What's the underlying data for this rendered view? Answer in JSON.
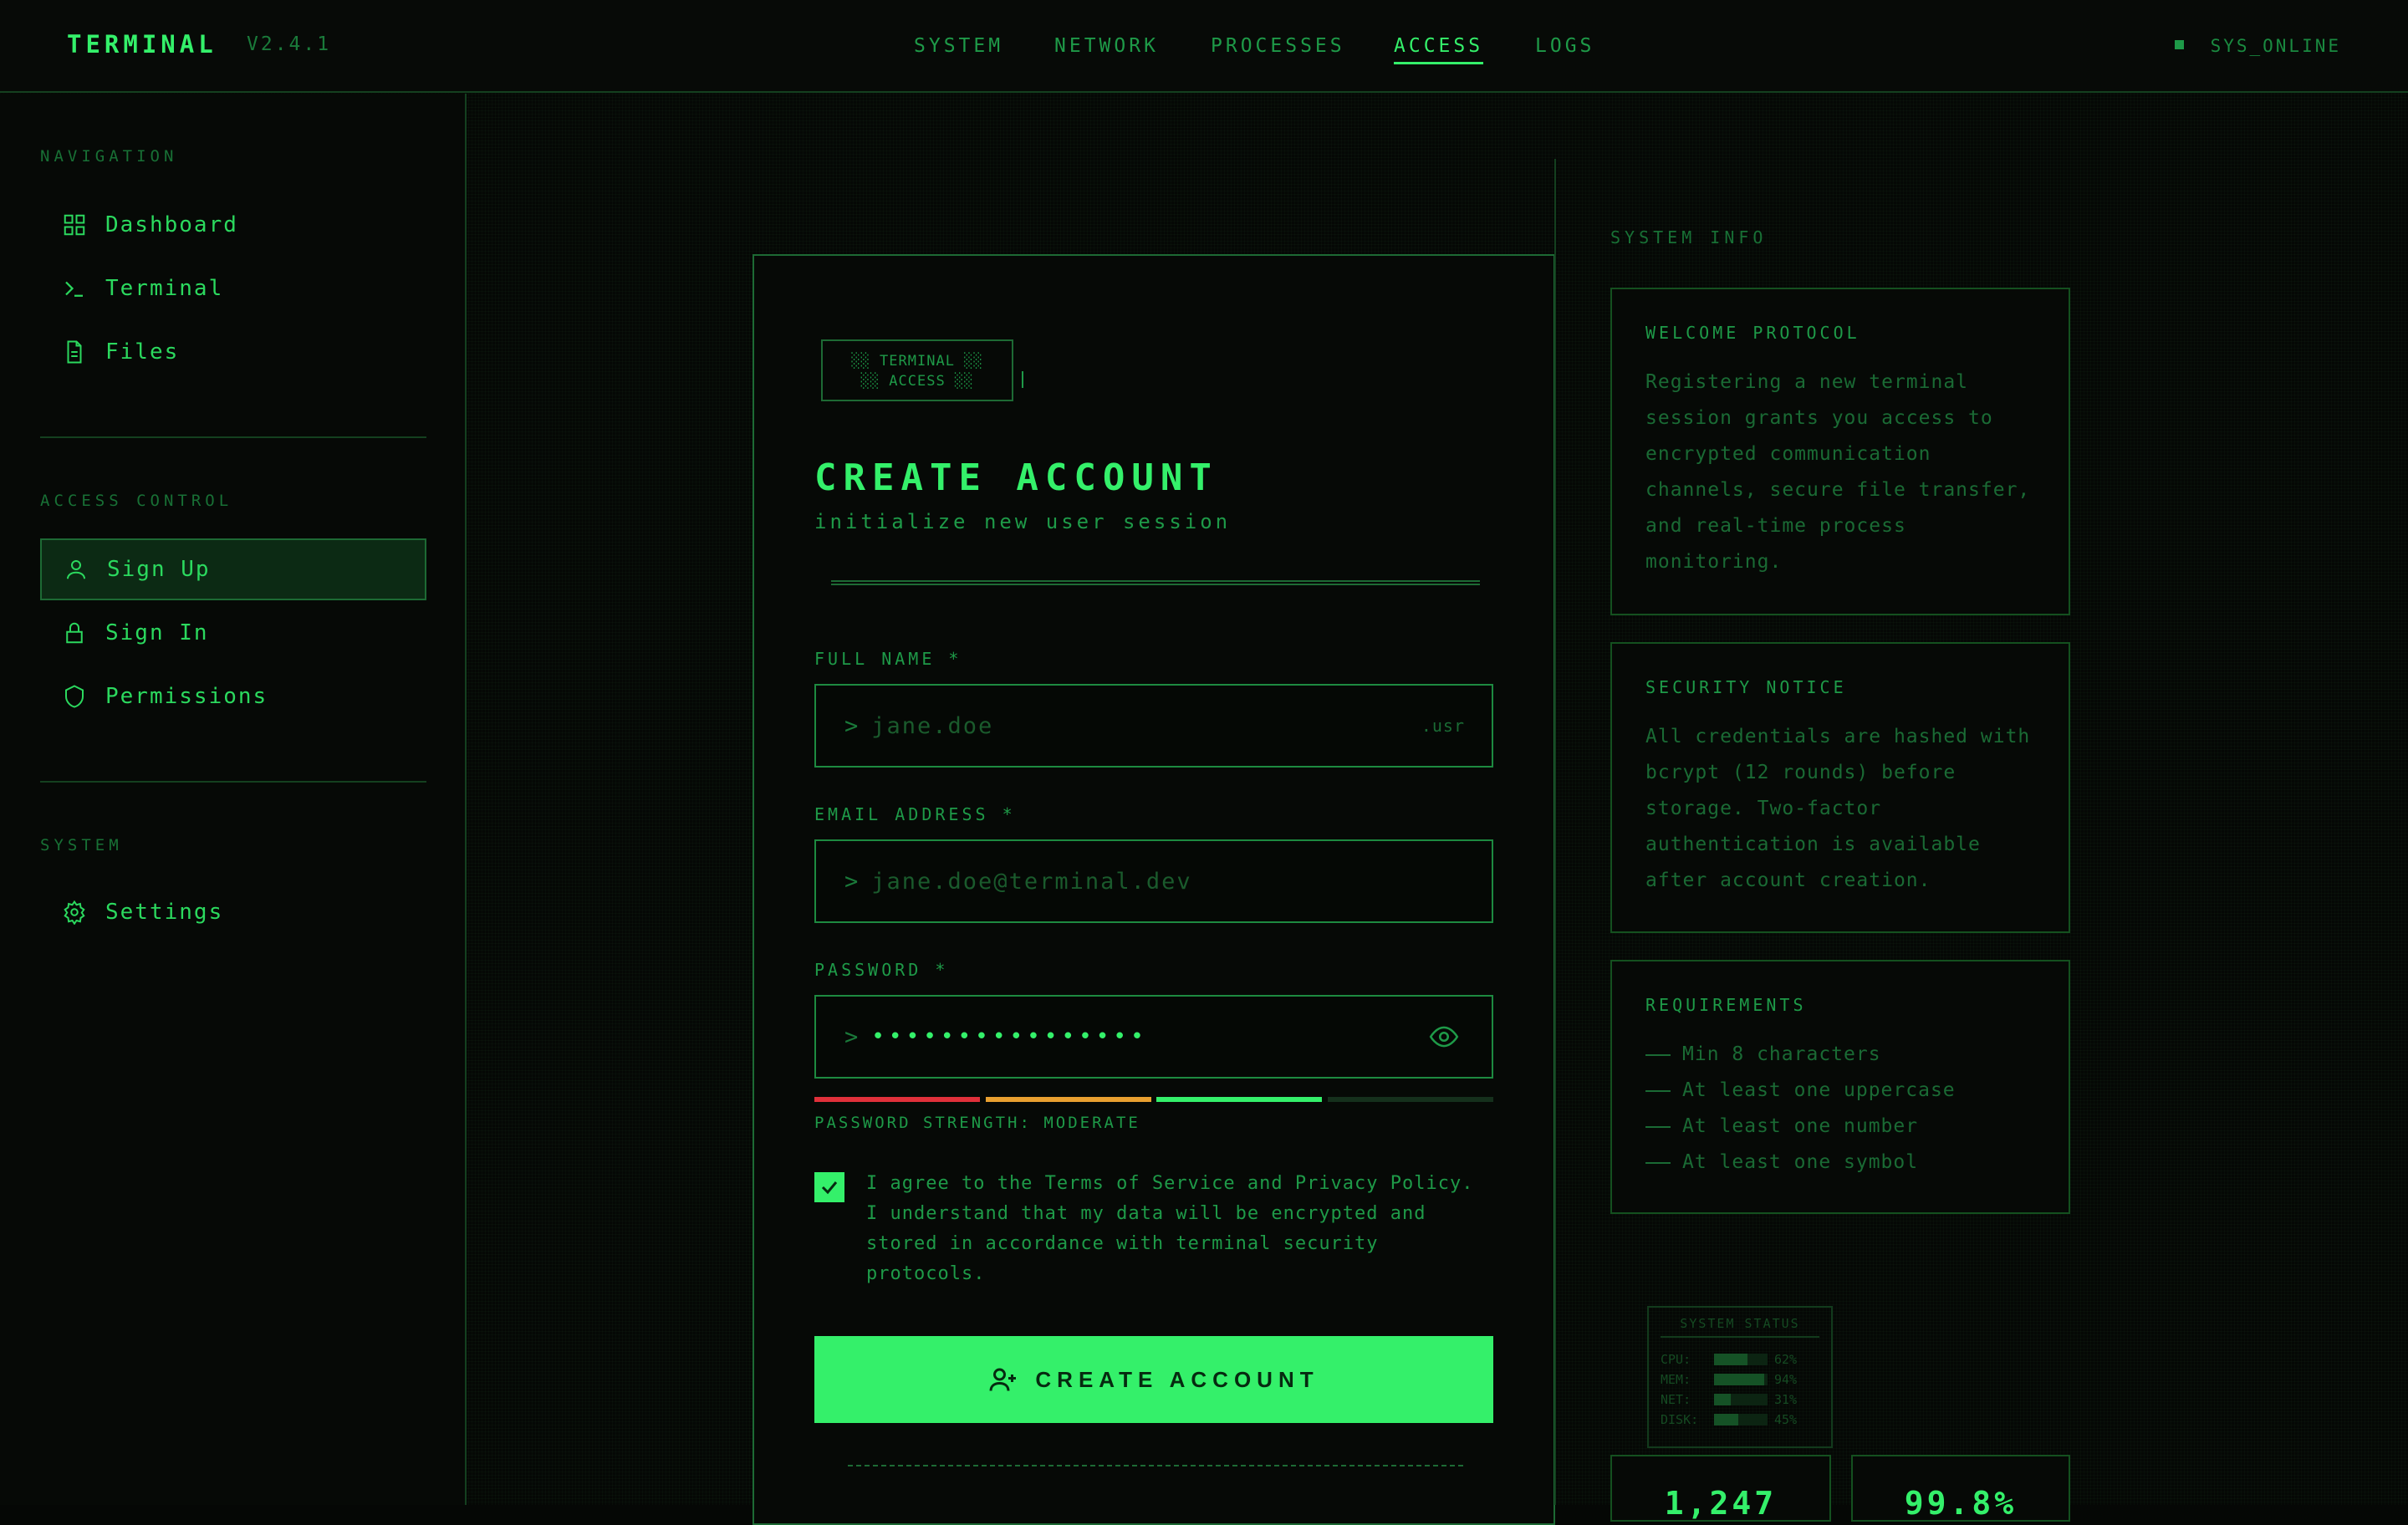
{
  "header": {
    "brand": "TERMINAL",
    "version": "V2.4.1",
    "nav": [
      "SYSTEM",
      "NETWORK",
      "PROCESSES",
      "ACCESS",
      "LOGS"
    ],
    "active_nav": "ACCESS",
    "status": "SYS_ONLINE"
  },
  "sidebar": {
    "navigation_title": "NAVIGATION",
    "navigation_items": [
      "Dashboard",
      "Terminal",
      "Files"
    ],
    "access_title": "ACCESS CONTROL",
    "access_items": [
      "Sign Up",
      "Sign In",
      "Permissions"
    ],
    "active_item": "Sign Up",
    "system_title": "SYSTEM",
    "system_items": [
      "Settings"
    ]
  },
  "form": {
    "logo_line1": "░░ TERMINAL ░░",
    "logo_line2": "░░ ACCESS ░░",
    "title": "CREATE ACCOUNT",
    "subtitle": "initialize new user session",
    "full_name_label": "FULL NAME *",
    "full_name_placeholder": "jane.doe",
    "full_name_suffix": ".usr",
    "email_label": "EMAIL ADDRESS *",
    "email_placeholder": "jane.doe@terminal.dev",
    "password_label": "PASSWORD *",
    "password_value": "••••••••••••••••",
    "prompt": ">",
    "strength_text": "PASSWORD STRENGTH: MODERATE",
    "strength_level": 0.75,
    "strength_colors": [
      "#e0303a",
      "#e8a030",
      "#34f06a",
      "#15301c"
    ],
    "consent": "I agree to the Terms of Service and Privacy Policy. I understand that my data will be encrypted and stored in accordance with terminal security protocols.",
    "consent_checked": true,
    "submit_label": "CREATE ACCOUNT"
  },
  "info": {
    "heading": "SYSTEM INFO",
    "welcome_title": "WELCOME PROTOCOL",
    "welcome_text": "Registering a new terminal session grants you access to encrypted communication channels, secure file transfer, and real-time process monitoring.",
    "security_title": "SECURITY NOTICE",
    "security_text": "All credentials are hashed with bcrypt (12 rounds) before storage. Two-factor authentication is available after account creation.",
    "requirements_title": "REQUIREMENTS",
    "requirements": [
      "Min 8 characters",
      "At least one uppercase",
      "At least one number",
      "At least one symbol"
    ],
    "system_status": {
      "title": "SYSTEM STATUS",
      "rows": [
        {
          "key": "CPU:",
          "value": "62%",
          "level": 0.62
        },
        {
          "key": "MEM:",
          "value": "94%",
          "level": 0.94
        },
        {
          "key": "NET:",
          "value": "31%",
          "level": 0.31
        },
        {
          "key": "DISK:",
          "value": "45%",
          "level": 0.45
        }
      ]
    },
    "stat1": "1,247",
    "stat2": "99.8%"
  },
  "colors": {
    "accent": "#34f06a",
    "muted": "#1e9a48",
    "border": "#1d6a34",
    "bg": "#050705"
  }
}
